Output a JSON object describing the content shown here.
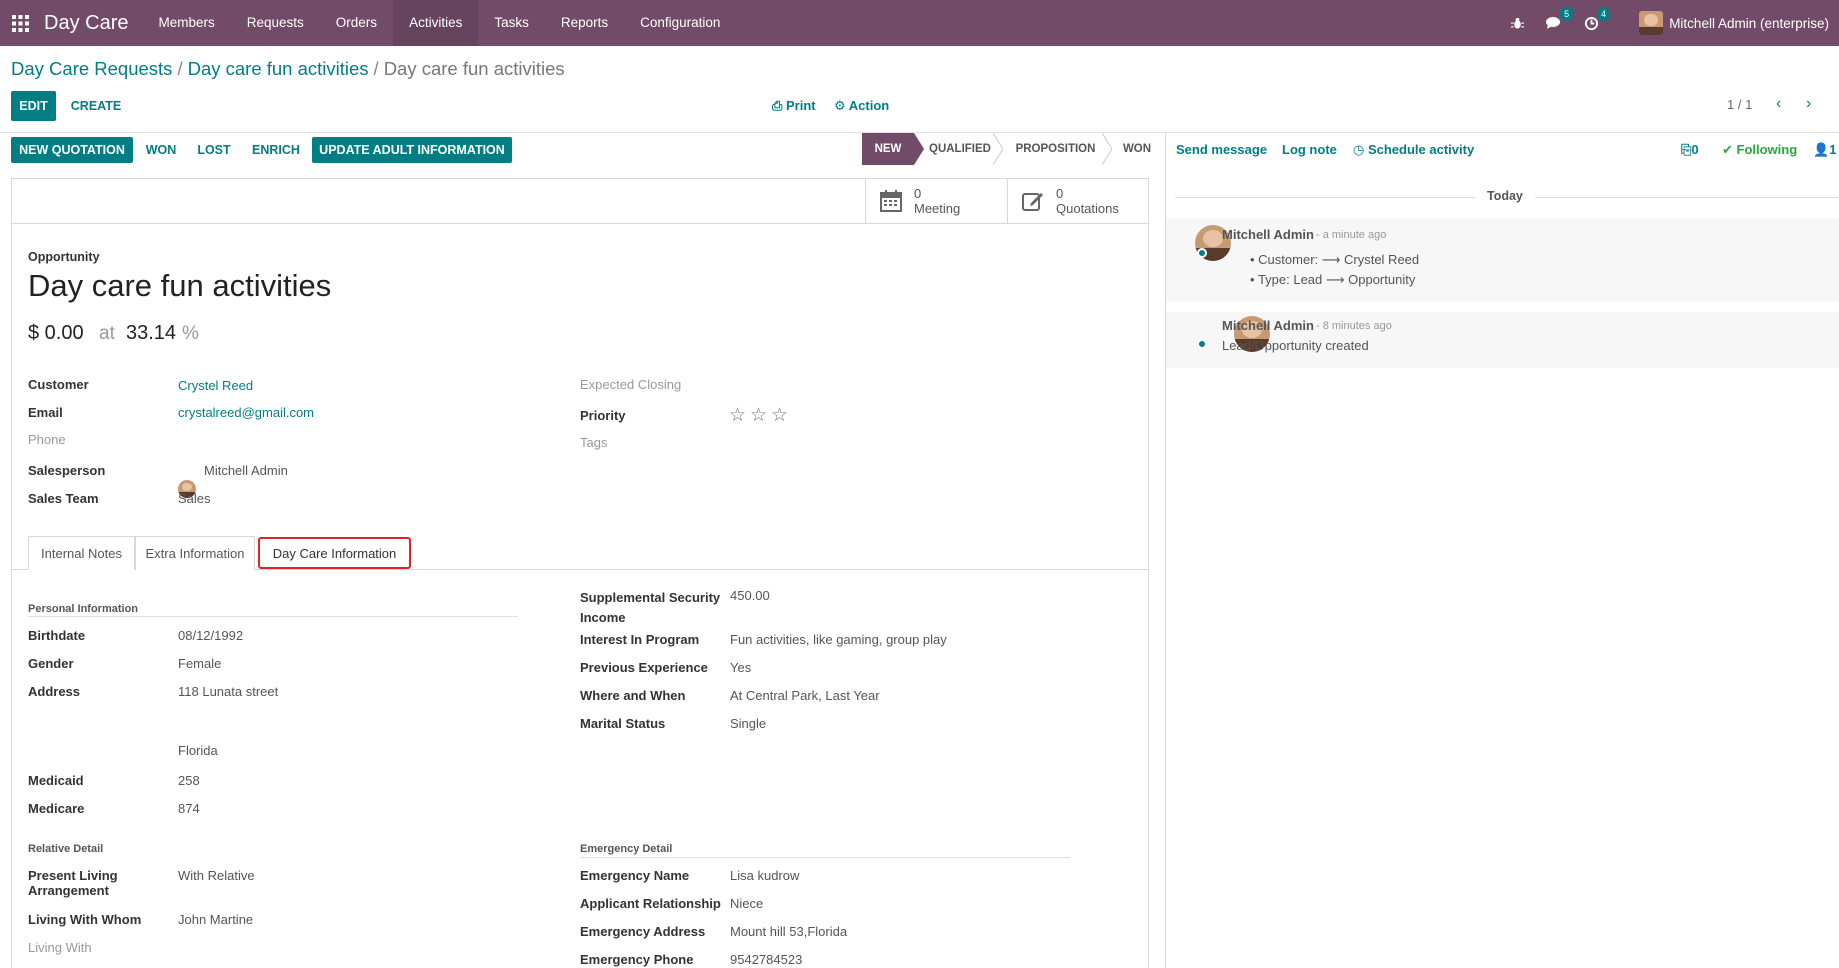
{
  "app": {
    "brand": "Day Care",
    "menu": [
      "Members",
      "Requests",
      "Orders",
      "Activities",
      "Tasks",
      "Reports",
      "Configuration"
    ],
    "active_menu": "Activities",
    "messages_badge": "5",
    "activities_badge": "4",
    "user": "Mitchell Admin (enterprise)"
  },
  "breadcrumb": {
    "crumb1": "Day Care Requests",
    "crumb2": "Day care fun activities",
    "current": "Day care fun activities",
    "separator": "/"
  },
  "controls": {
    "edit": "EDIT",
    "create": "CREATE",
    "print": "Print",
    "action": "Action",
    "pager": "1 / 1"
  },
  "statusbar": {
    "buttons": [
      "NEW QUOTATION",
      "WON",
      "LOST",
      "ENRICH",
      "UPDATE ADULT INFORMATION"
    ],
    "stages": [
      "NEW",
      "QUALIFIED",
      "PROPOSITION",
      "WON"
    ],
    "active_stage": "NEW"
  },
  "smart_buttons": {
    "meeting_count": "0",
    "meeting_label": "Meeting",
    "quotations_count": "0",
    "quotations_label": "Quotations"
  },
  "record": {
    "type_label": "Opportunity",
    "title": "Day care fun activities",
    "revenue": "$ 0.00",
    "at": "at",
    "probability": "33.14",
    "percent": "%"
  },
  "fields_left": {
    "customer_label": "Customer",
    "customer": "Crystel Reed",
    "email_label": "Email",
    "email": "crystalreed@gmail.com",
    "phone_label": "Phone",
    "salesperson_label": "Salesperson",
    "salesperson": "Mitchell Admin",
    "team_label": "Sales Team",
    "team": "Sales"
  },
  "fields_right": {
    "closing_label": "Expected Closing",
    "priority_label": "Priority",
    "tags_label": "Tags"
  },
  "tabs": [
    "Internal Notes",
    "Extra Information",
    "Day Care Information"
  ],
  "active_tab": "Day Care Information",
  "daycare": {
    "personal_title": "Personal Information",
    "birthdate_label": "Birthdate",
    "birthdate": "08/12/1992",
    "gender_label": "Gender",
    "gender": "Female",
    "address_label": "Address",
    "address": "118 Lunata street",
    "state": "Florida",
    "medicaid_label": "Medicaid",
    "medicaid": "258",
    "medicare_label": "Medicare",
    "medicare": "874",
    "ssi_label_1": "Supplemental Security",
    "ssi_label_2": "Income",
    "ssi": "450.00",
    "interest_label": "Interest In Program",
    "interest": "Fun activities, like gaming, group play",
    "experience_label": "Previous Experience",
    "experience": "Yes",
    "where_label": "Where and When",
    "where": "At Central Park, Last Year",
    "marital_label": "Marital Status",
    "marital": "Single",
    "relative_title": "Relative Detail",
    "living_label_1": "Present Living",
    "living_label_2": "Arrangement",
    "living": "With Relative",
    "whom_label": "Living With Whom",
    "whom": "John Martine",
    "living_with_label": "Living With",
    "emergency_title": "Emergency Detail",
    "em_name_label": "Emergency Name",
    "em_name": "Lisa kudrow",
    "em_rel_label": "Applicant Relationship",
    "em_rel": "Niece",
    "em_addr_label": "Emergency Address",
    "em_addr": "Mount hill 53,Florida",
    "em_phone_label": "Emergency Phone",
    "em_phone": "9542784523"
  },
  "chatter": {
    "send_message": "Send message",
    "log_note": "Log note",
    "schedule_activity": "Schedule activity",
    "attachments": "0",
    "following": "Following",
    "followers": "1",
    "today": "Today",
    "msg1": {
      "author": "Mitchell Admin",
      "date": "- a minute ago",
      "line1": "Customer: ⟶ Crystel Reed",
      "line2": "Type: Lead ⟶ Opportunity"
    },
    "msg2": {
      "author": "Mitchell Admin",
      "date": "- 8 minutes ago",
      "body": "Lead/Opportunity created"
    }
  },
  "colors": {
    "brand": "#714b67",
    "primary": "#017e84",
    "highlight": "#e02424",
    "following": "#28a745"
  }
}
